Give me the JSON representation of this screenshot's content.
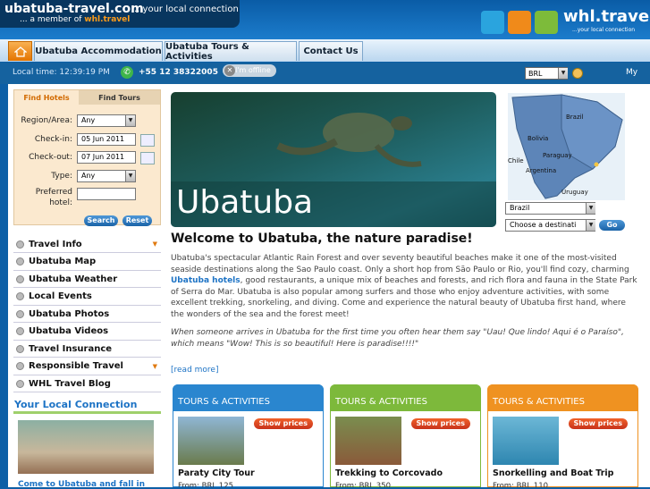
{
  "header": {
    "site_name": "ubatuba-travel.com",
    "tagline": "...your local connection",
    "member_prefix": "... a member of",
    "member_brand": "whl.travel",
    "brand_logo": "whl.travel",
    "brand_sub": "...your local connection"
  },
  "nav": {
    "home_icon": "home-icon",
    "tabs": [
      "Ubatuba Accommodation",
      "Ubatuba Tours & Activities",
      "Contact Us"
    ]
  },
  "infobar": {
    "local_time": "Local time: 12:39:19 PM",
    "phone": "+55 12 38322005",
    "offline": "I'm offline",
    "currency": "BRL",
    "my": "My"
  },
  "search": {
    "tab_hotels": "Find Hotels",
    "tab_tours": "Find Tours",
    "region_label": "Region/Area:",
    "region_value": "Any",
    "checkin_label": "Check-in:",
    "checkin_value": "05 Jun 2011",
    "checkout_label": "Check-out:",
    "checkout_value": "07 Jun 2011",
    "type_label": "Type:",
    "type_value": "Any",
    "preferred_label_1": "Preferred",
    "preferred_label_2": "hotel:",
    "search_btn": "Search",
    "reset_btn": "Reset"
  },
  "sidebar": {
    "items": [
      {
        "label": "Travel Info",
        "arrow": "▼"
      },
      {
        "label": "Ubatuba Map",
        "arrow": ""
      },
      {
        "label": "Ubatuba Weather",
        "arrow": ""
      },
      {
        "label": "Local Events",
        "arrow": ""
      },
      {
        "label": "Ubatuba Photos",
        "arrow": ""
      },
      {
        "label": "Ubatuba Videos",
        "arrow": ""
      },
      {
        "label": "Travel Insurance",
        "arrow": ""
      },
      {
        "label": "Responsible Travel",
        "arrow": "▼"
      },
      {
        "label": "WHL Travel Blog",
        "arrow": ""
      }
    ],
    "connection_title": "Your Local Connection",
    "connection_caption": "Come to Ubatuba and fall in"
  },
  "hero": {
    "title": "Ubatuba"
  },
  "map": {
    "countries": [
      "Brazil",
      "Bolivia",
      "Paraguay",
      "Chile",
      "Argentina",
      "Uruguay"
    ],
    "country_select": "Brazil",
    "destination_select": "Choose a destinati",
    "go": "Go"
  },
  "content": {
    "welcome": "Welcome to Ubatuba, the nature paradise!",
    "para1_a": "Ubatuba's spectacular Atlantic Rain Forest and over seventy beautiful beaches make it one of the most-visited seaside destinations along the Sao Paulo coast. Only a short hop from São Paulo or Rio, you'll find cozy, charming ",
    "para1_link": "Ubatuba hotels",
    "para1_b": ", good restaurants, a unique mix of beaches and forests, and rich flora and fauna in the State Park of Serra do Mar. Ubatuba is also popular among surfers and those who enjoy adventure activities, with some excellent trekking, snorkeling, and diving. Come and experience the natural beauty of Ubatuba first hand, where the wonders of the sea and the forest meet!",
    "para2": "When someone arrives in Ubatuba for the first time you often hear them say \"Uau! Que lindo! Aqui é o Paraíso\", which means \"Wow! This is so beautiful! Here is paradise!!!!\"",
    "read_more": "[read more]"
  },
  "cards": [
    {
      "head": "TOURS & ACTIVITIES",
      "btn": "Show prices",
      "title": "Paraty City Tour",
      "price": "From: BRL 125",
      "color": "#2a86cf"
    },
    {
      "head": "TOURS & ACTIVITIES",
      "btn": "Show prices",
      "title": "Trekking to Corcovado",
      "price": "From: BRL 350",
      "color": "#7db93b"
    },
    {
      "head": "TOURS & ACTIVITIES",
      "btn": "Show prices",
      "title": "Snorkelling and Boat Trip",
      "price": "From: BRL 110",
      "color": "#ef9221"
    }
  ]
}
